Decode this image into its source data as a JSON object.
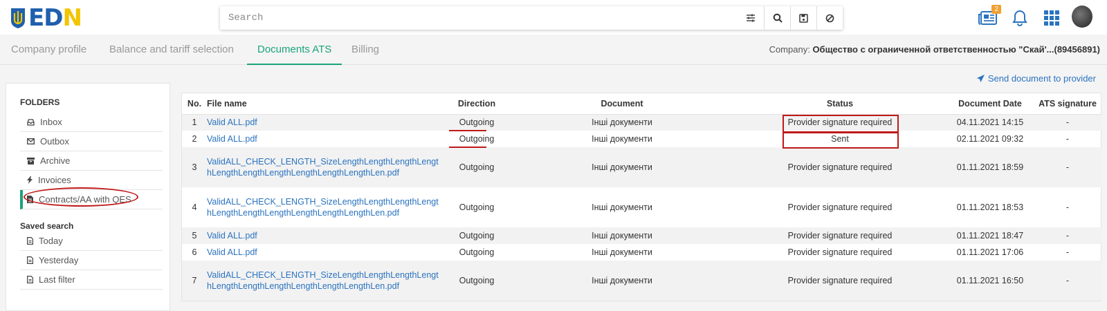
{
  "logo": {
    "e": "E",
    "d": "D",
    "n": "N"
  },
  "search": {
    "placeholder": "Search"
  },
  "topicons": {
    "documents_badge": "2"
  },
  "tabs": [
    {
      "label": "Company profile"
    },
    {
      "label": "Balance and tariff selection"
    },
    {
      "label": "Documents ATS"
    },
    {
      "label": "Billing"
    }
  ],
  "company": {
    "prefix": "Company:",
    "name": "Общество с ограниченной ответственностью \"Скай'...(89456891)"
  },
  "send_link": "Send document to provider",
  "sidebar": {
    "folders_title": "FOLDERS",
    "folders": [
      {
        "label": "Inbox",
        "icon": "inbox-icon"
      },
      {
        "label": "Outbox",
        "icon": "envelope-icon"
      },
      {
        "label": "Archive",
        "icon": "archive-icon"
      },
      {
        "label": "Invoices",
        "icon": "bolt-icon"
      },
      {
        "label": "Contracts/AA with QES",
        "icon": "document-icon"
      }
    ],
    "saved_title": "Saved search",
    "saved": [
      {
        "label": "Today"
      },
      {
        "label": "Yesterday"
      },
      {
        "label": "Last filter"
      }
    ]
  },
  "table": {
    "headers": [
      "No.",
      "File name",
      "Direction",
      "Document",
      "Status",
      "Document Date",
      "ATS signature"
    ],
    "rows": [
      {
        "no": "1",
        "file": "Valid ALL.pdf",
        "direction": "Outgoing",
        "document": "Інші документи",
        "status": "Provider signature required",
        "date": "04.11.2021 14:15",
        "ats": "-"
      },
      {
        "no": "2",
        "file": "Valid ALL.pdf",
        "direction": "Outgoing",
        "document": "Інші документи",
        "status": "Sent",
        "date": "02.11.2021 09:32",
        "ats": "-"
      },
      {
        "no": "3",
        "file": "ValidALL_CHECK_LENGTH_SizeLengthLengthLengthLengthLengthLengthLengthLengthLengthLengthLen.pdf",
        "direction": "Outgoing",
        "document": "Інші документи",
        "status": "Provider signature required",
        "date": "01.11.2021 18:59",
        "ats": "-"
      },
      {
        "no": "4",
        "file": "ValidALL_CHECK_LENGTH_SizeLengthLengthLengthLengthLengthLengthLengthLengthLengthLengthLen.pdf",
        "direction": "Outgoing",
        "document": "Інші документи",
        "status": "Provider signature required",
        "date": "01.11.2021 18:53",
        "ats": "-"
      },
      {
        "no": "5",
        "file": "Valid ALL.pdf",
        "direction": "Outgoing",
        "document": "Інші документи",
        "status": "Provider signature required",
        "date": "01.11.2021 18:47",
        "ats": "-"
      },
      {
        "no": "6",
        "file": "Valid ALL.pdf",
        "direction": "Outgoing",
        "document": "Інші документи",
        "status": "Provider signature required",
        "date": "01.11.2021 17:06",
        "ats": "-"
      },
      {
        "no": "7",
        "file": "ValidALL_CHECK_LENGTH_SizeLengthLengthLengthLengthLengthLengthLengthLengthLengthLengthLen.pdf",
        "direction": "Outgoing",
        "document": "Інші документи",
        "status": "Provider signature required",
        "date": "01.11.2021 16:50",
        "ats": "-"
      }
    ]
  }
}
